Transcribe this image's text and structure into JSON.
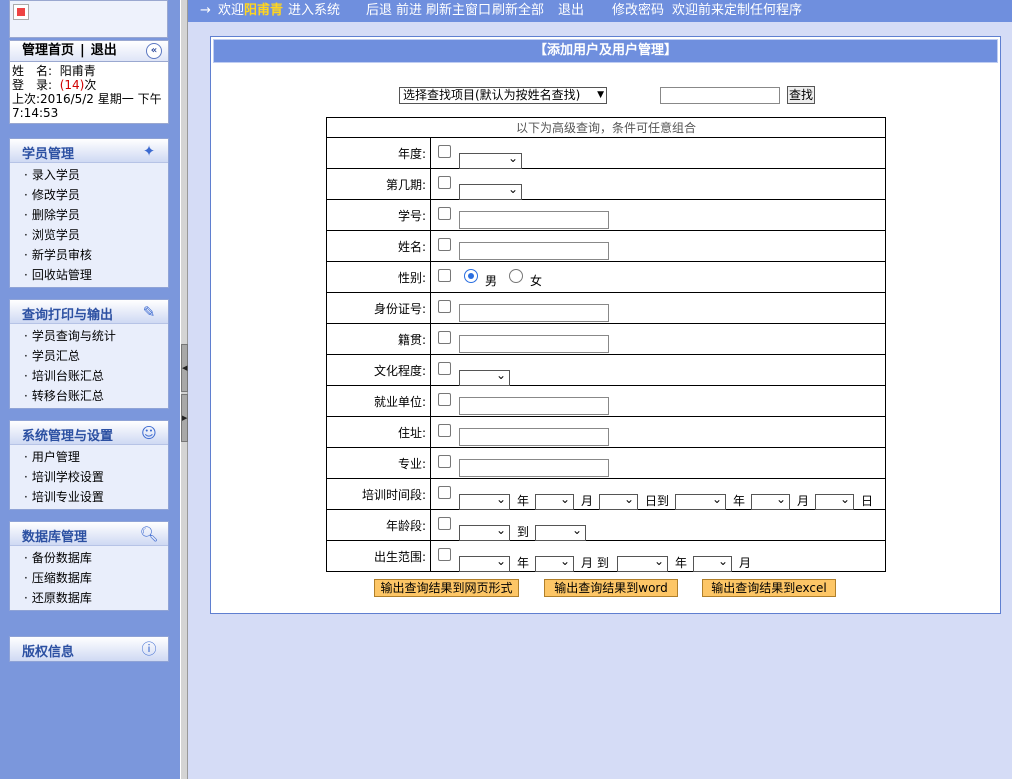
{
  "top_nav": {
    "arrow": "→",
    "welcome": "欢迎",
    "username": "阳甫青",
    "enter_system": "进入系统",
    "back": "后退",
    "forward": "前进",
    "refresh_main": "刷新主窗口",
    "refresh_all": "刷新全部",
    "logout": "退出",
    "change_password": "修改密码",
    "custom": "欢迎前来定制任何程序"
  },
  "user_panel": {
    "home": "管理首页",
    "separator": "|",
    "logout": "退出",
    "collapse_icon": "double-chevron-left",
    "name_label": "姓　名:",
    "name_value": "阳甫青",
    "login_label": "登　录:",
    "login_count": "(14)",
    "login_suffix": "次",
    "last_label": "上次:",
    "last_value": "2016/5/2 星期一 下午 7:14:53"
  },
  "menus": [
    {
      "title": "学员管理",
      "icon": "student-management-icon",
      "items": [
        "录入学员",
        "修改学员",
        "删除学员",
        "浏览学员",
        "新学员审核",
        "回收站管理"
      ]
    },
    {
      "title": "查询打印与输出",
      "icon": "edit-note-icon",
      "items": [
        "学员查询与统计",
        "学员汇总",
        "培训台账汇总",
        "转移台账汇总"
      ]
    },
    {
      "title": "系统管理与设置",
      "icon": "user-settings-icon",
      "items": [
        "用户管理",
        "培训学校设置",
        "培训专业设置"
      ]
    },
    {
      "title": "数据库管理",
      "icon": "magnifier-icon",
      "items": [
        "备份数据库",
        "压缩数据库",
        "还原数据库"
      ]
    },
    {
      "title": "版权信息",
      "icon": "info-icon",
      "items": []
    }
  ],
  "main": {
    "title": "【添加用户及用户管理】",
    "search_select": "选择查找项目(默认为按姓名查找)",
    "search_button": "查找",
    "table_header": "以下为高级查询，条件可任意组合",
    "rows": {
      "year": "年度:",
      "period": "第几期:",
      "student_no": "学号:",
      "name": "姓名:",
      "gender": "性别:",
      "id_no": "身份证号:",
      "native": "籍贯:",
      "education": "文化程度:",
      "employer": "就业单位:",
      "address": "住址:",
      "major": "专业:",
      "training_period": "培训时间段:",
      "age_range": "年龄段:",
      "birth_range": "出生范围:"
    },
    "male": "男",
    "female": "女",
    "unit_year": "年",
    "unit_month": "月",
    "unit_day_to": "日到",
    "unit_day": "日",
    "to": "到",
    "month_to": "月 到",
    "output_web": "输出查询结果到网页形式",
    "output_word": "输出查询结果到word",
    "output_excel": "输出查询结果到excel"
  },
  "colors": {
    "topbar": "#6f8fde",
    "sidebar": "#7b97dc",
    "username": "#ffd51f",
    "button": "#fdc666"
  }
}
